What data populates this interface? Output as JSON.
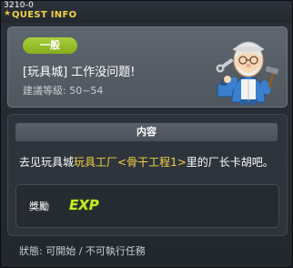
{
  "window": {
    "id": "3210-0",
    "title": "QUEST INFO",
    "title_icon": "star-icon"
  },
  "header": {
    "category": "一般",
    "quest_title": "[玩具城] 工作没问题!",
    "level_label": "建議等級: 50~54",
    "npc": "toy-factory-mechanic-npc"
  },
  "content": {
    "section_title": "内容",
    "description_parts": [
      "去见玩具城",
      "玩具工厂<骨干工程1>",
      "里的厂长卡胡吧。"
    ],
    "reward_label": "獎勵",
    "reward_type": "EXP"
  },
  "status_bar": "狀態: 可開始 / 不可執行任務",
  "colors": {
    "accent": "#f2d245",
    "badge": "#9bc12d"
  }
}
